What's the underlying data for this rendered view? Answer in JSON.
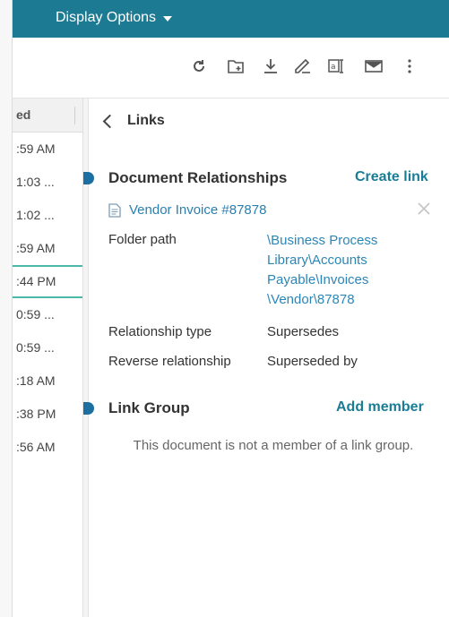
{
  "header": {
    "display_options_label": "Display Options"
  },
  "toolbar": {
    "icons": [
      "refresh-icon",
      "add-folder-icon",
      "download-icon",
      "signature-icon",
      "text-field-icon",
      "email-icon",
      "more-vertical-icon"
    ]
  },
  "list": {
    "header_label": "ed",
    "rows": [
      ":59 AM",
      "1:03 ...",
      "1:02 ...",
      ":59 AM",
      ":44 PM",
      "0:59 ...",
      "0:59 ...",
      ":18 AM",
      ":38 PM",
      ":56 AM"
    ],
    "selected_index": 4
  },
  "panel": {
    "back_label": "Links",
    "relationships": {
      "title": "Document Relationships",
      "create_link_label": "Create link",
      "document_label": "Vendor Invoice #87878",
      "folder_path_label": "Folder path",
      "folder_path_lines": [
        "\\Business Process",
        "Library\\Accounts",
        "Payable\\Invoices",
        "\\Vendor\\87878"
      ],
      "relationship_type_label": "Relationship type",
      "relationship_type_value": "Supersedes",
      "reverse_relationship_label": "Reverse relationship",
      "reverse_relationship_value": "Superseded by"
    },
    "link_group": {
      "title": "Link Group",
      "add_member_label": "Add member",
      "empty_message": "This document is not a member of a link group."
    }
  },
  "colors": {
    "topbar": "#1c7a93",
    "link": "#1a7d96",
    "path_link": "#2a86b8",
    "selected_row_border": "#4bb8a8"
  }
}
